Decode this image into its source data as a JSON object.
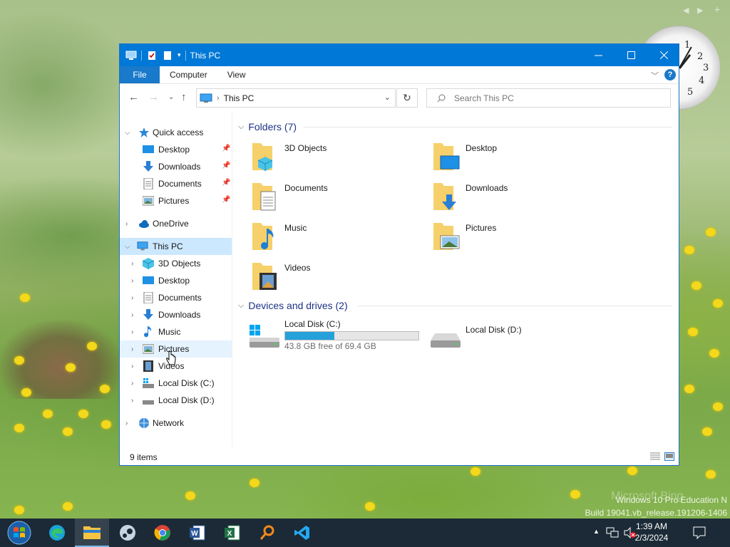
{
  "window": {
    "title": "This PC",
    "ribbon_tabs": [
      "File",
      "Computer",
      "View"
    ],
    "address": "This PC",
    "search_placeholder": "Search This PC",
    "status": "9 items"
  },
  "sidebar": {
    "quick_access": "Quick access",
    "qa_items": [
      "Desktop",
      "Downloads",
      "Documents",
      "Pictures"
    ],
    "onedrive": "OneDrive",
    "this_pc": "This PC",
    "pc_items": [
      "3D Objects",
      "Desktop",
      "Documents",
      "Downloads",
      "Music",
      "Pictures",
      "Videos",
      "Local Disk (C:)",
      "Local Disk (D:)"
    ],
    "network": "Network"
  },
  "folders": {
    "header": "Folders (7)",
    "items": [
      "3D Objects",
      "Desktop",
      "Documents",
      "Downloads",
      "Music",
      "Pictures",
      "Videos"
    ]
  },
  "drives": {
    "header": "Devices and drives (2)",
    "items": [
      {
        "name": "Local Disk (C:)",
        "free": "43.8 GB free of 69.4 GB",
        "used_fraction": 0.369
      },
      {
        "name": "Local Disk (D:)"
      }
    ]
  },
  "watermark": {
    "line1": "Windows 10 Pro Education N",
    "line2": "Build 19041.vb_release.191206-1406",
    "bing": "Microsoft Bing"
  },
  "clock": {
    "time": "1:39 AM",
    "date": "2/3/2024",
    "dial_numbers": [
      "1",
      "2",
      "3",
      "4",
      "5"
    ]
  },
  "taskbar": {
    "apps": [
      "start-icon",
      "edge-icon",
      "file-explorer-icon",
      "steam-icon",
      "chrome-icon",
      "word-icon",
      "excel-icon",
      "search-tool-icon",
      "vscode-icon"
    ]
  },
  "colors": {
    "titlebar": "#0078d7",
    "selection": "#cce8ff",
    "group_header": "#1e3287",
    "drive_bar": "#26a0da",
    "taskbar": "#1b2a36"
  }
}
